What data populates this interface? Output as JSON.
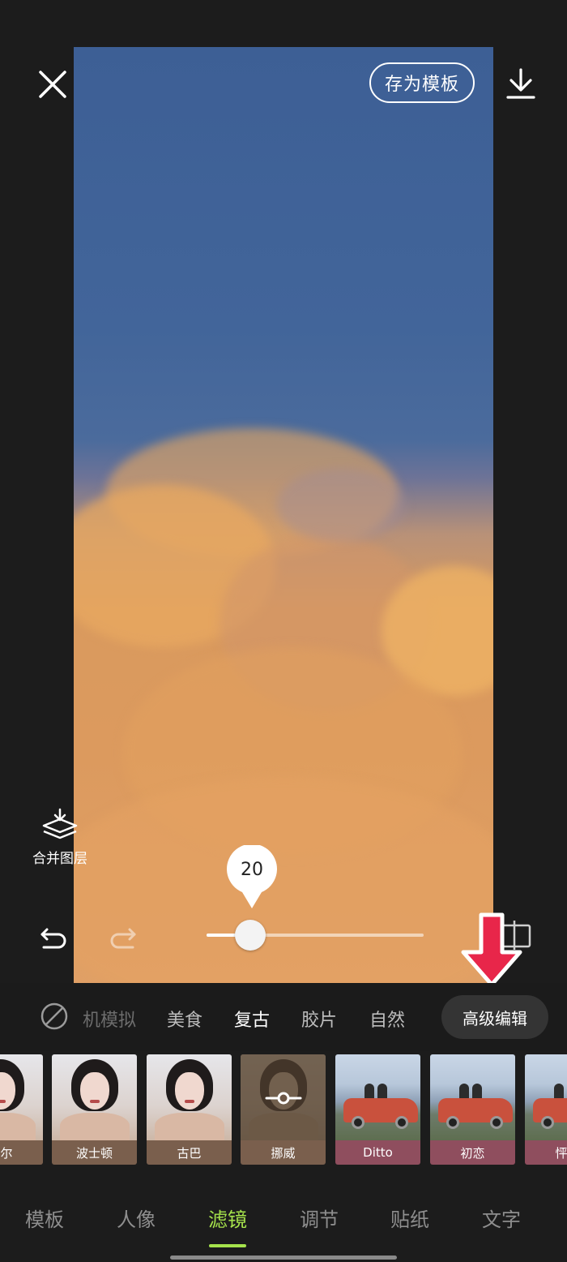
{
  "toolbar": {
    "close_icon": "close-icon",
    "save_template_label": "存为模板",
    "download_icon": "download-icon"
  },
  "side_tools": {
    "merge_layers_label": "合并图层",
    "merge_layers_icon": "layers-merge-icon"
  },
  "controls": {
    "undo_icon": "undo-icon",
    "redo_icon": "redo-icon",
    "compare_icon": "compare-icon"
  },
  "intensity_slider": {
    "value": "20",
    "fraction": 0.2
  },
  "categories": {
    "none_icon": "no-filter-icon",
    "items": [
      "机模拟",
      "美食",
      "复古",
      "胶片",
      "自然"
    ],
    "active": "复古",
    "advanced_label": "高级编辑"
  },
  "filters": [
    {
      "name": "海尔",
      "style": "portrait",
      "label_color": "#7a5f4d"
    },
    {
      "name": "波士顿",
      "style": "portrait",
      "label_color": "#7a5f4d"
    },
    {
      "name": "古巴",
      "style": "portrait",
      "label_color": "#7a5f4d"
    },
    {
      "name": "挪威",
      "style": "portrait-selected",
      "label_color": "#7a5f4d"
    },
    {
      "name": "Ditto",
      "style": "car",
      "label_color": "#8f4e5e"
    },
    {
      "name": "初恋",
      "style": "car",
      "label_color": "#8f4e5e"
    },
    {
      "name": "怦然",
      "style": "car",
      "label_color": "#8f4e5e"
    }
  ],
  "bottom_nav": {
    "items": [
      "模板",
      "人像",
      "滤镜",
      "调节",
      "贴纸",
      "文字"
    ],
    "active": "滤镜"
  },
  "colors": {
    "accent": "#a6e34c",
    "annotation_arrow": "#e8264a",
    "background": "#1c1c1c"
  }
}
